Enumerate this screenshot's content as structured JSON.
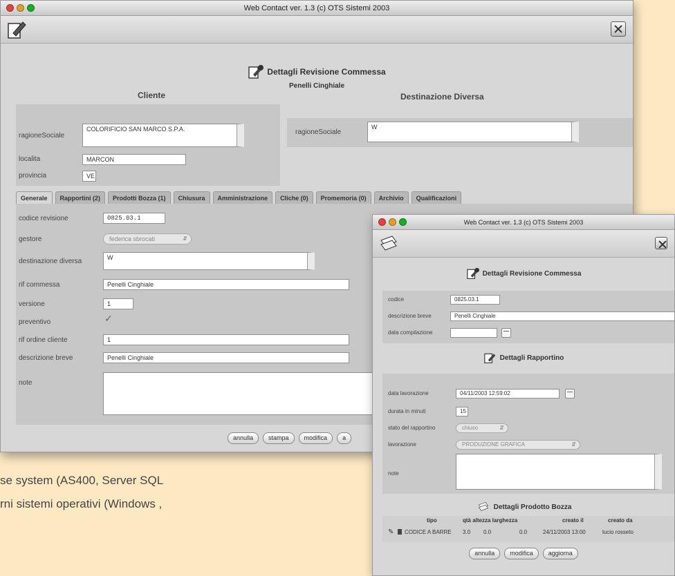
{
  "caption": {
    "line1": "se system (AS400, Server SQL",
    "line2": "rni sistemi operativi (Windows ,"
  },
  "main_window": {
    "title": "Web Contact ver. 1.3 (c) OTS Sistemi 2003",
    "header_title": "Dettagli Revisione Commessa",
    "subtitle": "Penelli Cinghiale",
    "cliente_heading": "Cliente",
    "destinazione_heading": "Destinazione Diversa",
    "cliente": {
      "ragione_label": "ragioneSociale",
      "ragione_value": "COLORIFICIO SAN MARCO S.P.A.",
      "localita_label": "localita",
      "localita_value": "MARCON",
      "provincia_label": "provincia",
      "provincia_value": "VE"
    },
    "destinazione": {
      "ragione_label": "ragioneSociale",
      "ragione_value": "W"
    },
    "tabs": [
      "Generale",
      "Rapportini (2)",
      "Prodotti Bozza (1)",
      "Chiusura",
      "Amministrazione",
      "Cliche (0)",
      "Promemoria (0)",
      "Archivio",
      "Qualificazioni"
    ],
    "form": {
      "codice_label": "codice revisione",
      "codice_value": "0825.03.1",
      "gestore_label": "gestore",
      "gestore_value": "federica sbrocati",
      "destinazione_label": "destinazione diversa",
      "destinazione_value": "W",
      "commessa_label": "rif commessa",
      "commessa_value": "Penelli Cinghiale",
      "versione_label": "versione",
      "versione_value": "1",
      "preventivo_label": "preventivo",
      "preventivo_check": "✓",
      "ordine_label": "rif ordine cliente",
      "ordine_value": "1",
      "descrizione_label": "descrizione breve",
      "descrizione_value": "Penelli Cinghiale",
      "note_label": "note",
      "note_value": ""
    },
    "buttons": [
      "annulla",
      "stampa",
      "modifica",
      "a"
    ]
  },
  "second_window": {
    "title": "Web Contact ver. 1.3 (c) OTS Sistemi 2003",
    "header_title": "Dettagli Revisione Commessa",
    "codice_label": "codice",
    "codice_value": "0825.03.1",
    "descrizione_label": "descrizione breve",
    "descrizione_value": "Penelli Cinghiale",
    "data_label": "data compilazione",
    "data_value": "",
    "rapportino_title": "Dettagli Rapportino",
    "rapportino": {
      "data_lav_label": "data lavorazione",
      "data_lav_value": "04/11/2003 12:59:02",
      "durata_label": "durata in minuti",
      "durata_value": "15",
      "stato_label": "stato del rapportino",
      "stato_value": "chiuso",
      "lavorazione_label": "lavorazione",
      "lavorazione_value": "PRODUZIONE GRAFICA",
      "note_label": "note",
      "note_value": ""
    },
    "prodotto_title": "Dettagli Prodotto Bozza",
    "table": {
      "headers": [
        "tipo",
        "qtà altezza larghezza",
        "creato il",
        "creato da"
      ],
      "row": {
        "tipo": "CODICE A BARRE",
        "qta": "3.0",
        "altezza": "0.0",
        "larghezza": "0.0",
        "creato_il": "24/11/2003 13:00",
        "creato_da": "lucio rosseto"
      }
    },
    "buttons": [
      "annulla",
      "modifica",
      "aggiorna"
    ]
  },
  "colors": {
    "page_bg": "#fce9c2",
    "window_bg": "#d7d7d7",
    "panel_bg": "#c7c7c7"
  }
}
